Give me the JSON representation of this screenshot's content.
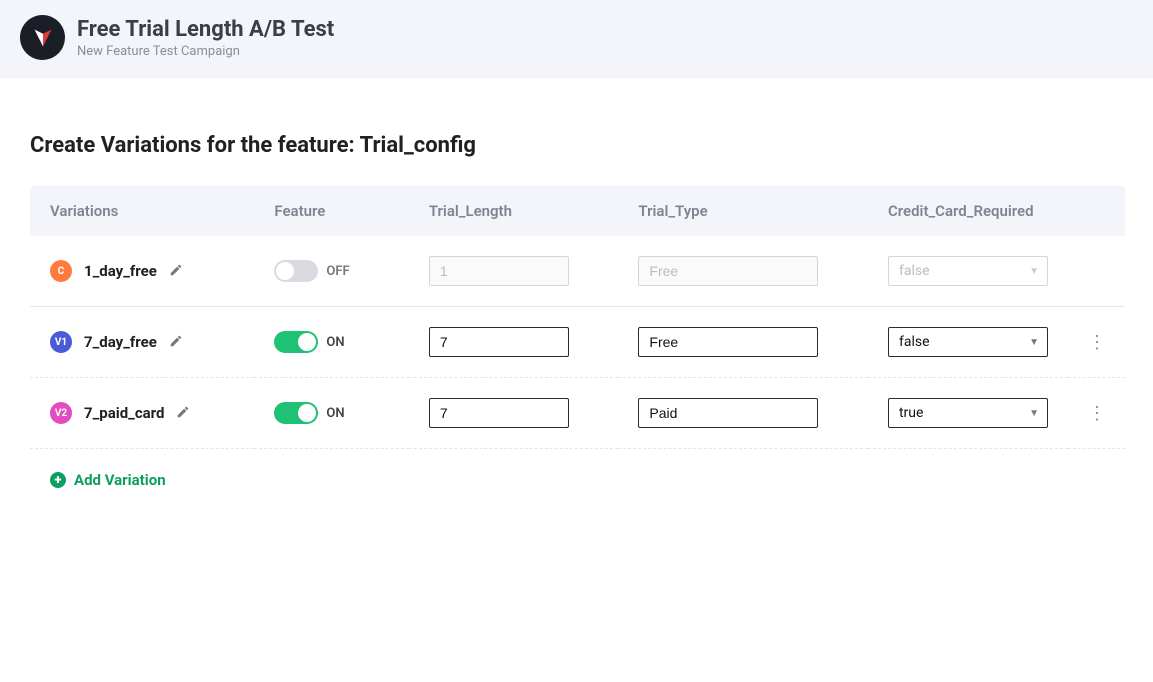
{
  "header": {
    "title": "Free Trial Length A/B Test",
    "subtitle": "New Feature Test Campaign"
  },
  "page": {
    "heading_prefix": "Create Variations for the feature: ",
    "feature_name": "Trial_config"
  },
  "table": {
    "columns": {
      "variations": "Variations",
      "feature": "Feature",
      "trial_length": "Trial_Length",
      "trial_type": "Trial_Type",
      "cc_required": "Credit_Card_Required"
    }
  },
  "rows": [
    {
      "badge": "C",
      "badge_class": "badge-c",
      "name": "1_day_free",
      "feature_on": false,
      "feature_label": "OFF",
      "trial_length": "1",
      "trial_type": "Free",
      "cc_required": "false",
      "disabled": true,
      "has_more": false
    },
    {
      "badge": "V1",
      "badge_class": "badge-v1",
      "name": "7_day_free",
      "feature_on": true,
      "feature_label": "ON",
      "trial_length": "7",
      "trial_type": "Free",
      "cc_required": "false",
      "disabled": false,
      "has_more": true
    },
    {
      "badge": "V2",
      "badge_class": "badge-v2",
      "name": "7_paid_card",
      "feature_on": true,
      "feature_label": "ON",
      "trial_length": "7",
      "trial_type": "Paid",
      "cc_required": "true",
      "disabled": false,
      "has_more": true
    }
  ],
  "actions": {
    "add_variation": "Add Variation"
  }
}
